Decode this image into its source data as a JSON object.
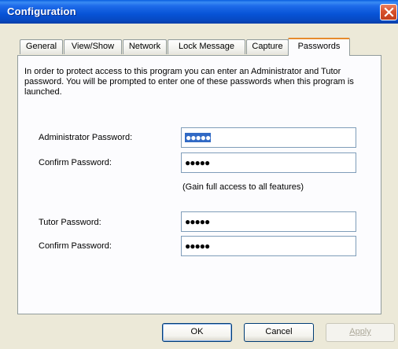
{
  "window": {
    "title": "Configuration"
  },
  "tabs": [
    "General",
    "View/Show",
    "Network",
    "Lock Message",
    "Capture",
    "Passwords"
  ],
  "active_tab": "Passwords",
  "intro": "In order to protect access to this program you can enter an Administrator and Tutor password.  You will be prompted to enter one of these passwords when this program is launched.",
  "fields": {
    "admin_label": "Administrator Password:",
    "admin_value": "●●●●●",
    "admin_confirm_label": "Confirm Password:",
    "admin_confirm_value": "●●●●●",
    "admin_note": "(Gain full access to all features)",
    "tutor_label": "Tutor Password:",
    "tutor_value": "●●●●●",
    "tutor_confirm_label": "Confirm Password:",
    "tutor_confirm_value": "●●●●●"
  },
  "buttons": {
    "ok": "OK",
    "cancel": "Cancel",
    "apply": "Apply"
  }
}
